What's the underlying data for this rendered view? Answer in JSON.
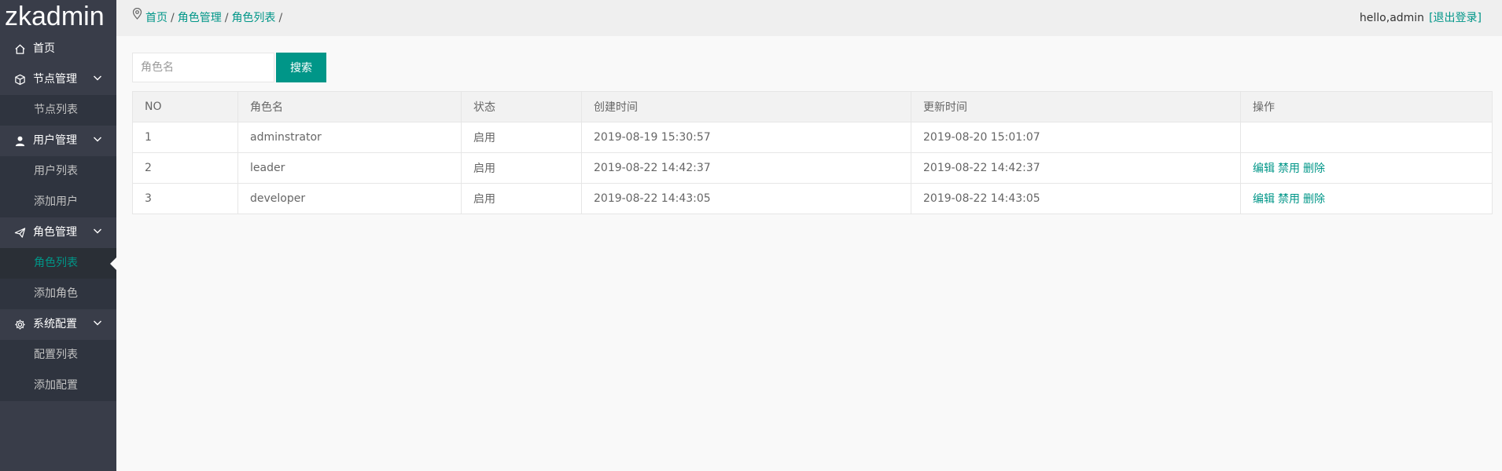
{
  "app": {
    "logo": "zkadmin"
  },
  "sidebar": {
    "items": [
      {
        "label": "首页",
        "icon": "home-icon"
      },
      {
        "label": "节点管理",
        "icon": "cube-icon",
        "children": [
          {
            "label": "节点列表"
          }
        ]
      },
      {
        "label": "用户管理",
        "icon": "user-icon",
        "children": [
          {
            "label": "用户列表"
          },
          {
            "label": "添加用户"
          }
        ]
      },
      {
        "label": "角色管理",
        "icon": "paper-plane-icon",
        "children": [
          {
            "label": "角色列表",
            "active": true
          },
          {
            "label": "添加角色"
          }
        ]
      },
      {
        "label": "系统配置",
        "icon": "gear-icon",
        "children": [
          {
            "label": "配置列表"
          },
          {
            "label": "添加配置"
          }
        ]
      }
    ]
  },
  "header": {
    "breadcrumb": [
      "首页",
      "角色管理",
      "角色列表"
    ],
    "separator": "/",
    "greeting": "hello,admin",
    "logout": "[退出登录]"
  },
  "search": {
    "placeholder": "角色名",
    "value": "",
    "button": "搜索"
  },
  "table": {
    "headers": [
      "NO",
      "角色名",
      "状态",
      "创建时间",
      "更新时间",
      "操作"
    ],
    "rows": [
      {
        "no": "1",
        "name": "adminstrator",
        "status": "启用",
        "created": "2019-08-19 15:30:57",
        "updated": "2019-08-20 15:01:07",
        "actions": []
      },
      {
        "no": "2",
        "name": "leader",
        "status": "启用",
        "created": "2019-08-22 14:42:37",
        "updated": "2019-08-22 14:42:37",
        "actions": [
          "编辑",
          "禁用",
          "删除"
        ]
      },
      {
        "no": "3",
        "name": "developer",
        "status": "启用",
        "created": "2019-08-22 14:43:05",
        "updated": "2019-08-22 14:43:05",
        "actions": [
          "编辑",
          "禁用",
          "删除"
        ]
      }
    ]
  },
  "colors": {
    "accent": "#009688",
    "sidebar_bg": "#393d49",
    "submenu_bg": "#2f343f"
  }
}
